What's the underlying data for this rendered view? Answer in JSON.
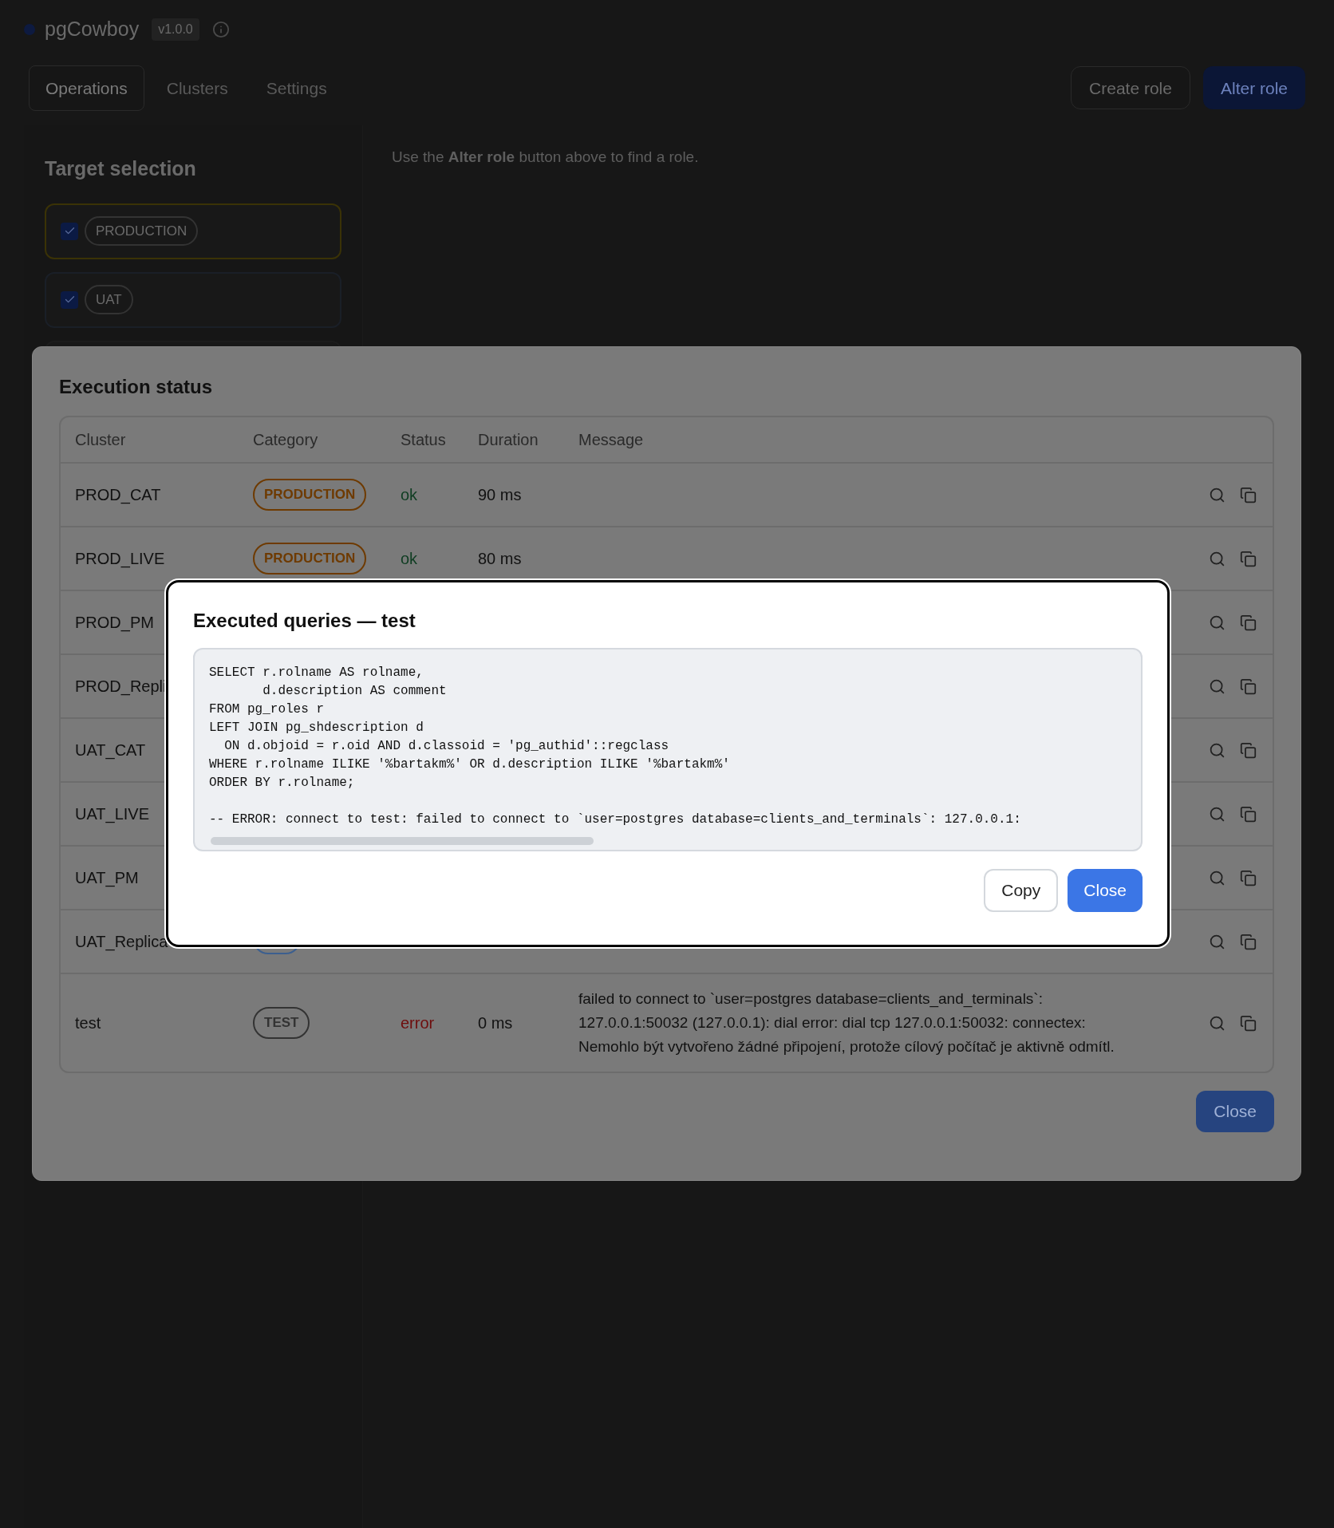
{
  "app": {
    "name": "pgCowboy",
    "version": "v1.0.0",
    "tabs": [
      {
        "label": "Operations",
        "selected": true
      },
      {
        "label": "Clusters",
        "selected": false
      },
      {
        "label": "Settings",
        "selected": false
      }
    ],
    "actions": [
      {
        "label": "Create role",
        "kind": "secondary"
      },
      {
        "label": "Alter role",
        "kind": "primary"
      }
    ],
    "sidebar": {
      "title": "Target selection",
      "targets": [
        {
          "label": "PRODUCTION",
          "checked": true,
          "color": "#3a3206"
        },
        {
          "label": "UAT",
          "checked": true,
          "color": "#1a1f27"
        }
      ]
    },
    "main_hint": "Use the **Alter role** button above to find a role."
  },
  "execution": {
    "title": "Execution status",
    "columns": [
      "Cluster",
      "Category",
      "Status",
      "Duration",
      "Message"
    ],
    "rows": [
      {
        "cluster": "PROD_CAT",
        "category": {
          "label": "PRODUCTION",
          "color": "#6e3a00"
        },
        "status": {
          "label": "ok",
          "kind": "ok"
        },
        "duration": "90 ms"
      },
      {
        "cluster": "PROD_LIVE",
        "category": {
          "label": "PRODUCTION",
          "color": "#6e3a00"
        },
        "status": {
          "label": "ok",
          "kind": "ok"
        },
        "duration": "80 ms"
      },
      {
        "cluster": "PROD_PM"
      },
      {
        "cluster": "PROD_Repli"
      },
      {
        "cluster": "UAT_CAT"
      },
      {
        "cluster": "UAT_LIVE"
      },
      {
        "cluster": "UAT_PM"
      },
      {
        "cluster": "UAT_Replica",
        "category": {
          "color": "#3c5f8f"
        }
      },
      {
        "cluster": "test",
        "category": {
          "label": "TEST",
          "color": "#333333"
        },
        "status": {
          "label": "error",
          "kind": "error"
        },
        "duration": "0 ms",
        "message": "failed to connect to `user=postgres database=clients_and_terminals`: 127.0.0.1:50032 (127.0.0.1): dial error: dial tcp 127.0.0.1:50032: connectex: Nemohlo být vytvořeno žádné připojení, protože cílový počítač je aktivně odmítl."
      }
    ],
    "close_label": "Close"
  },
  "dialog": {
    "title": "Executed queries — test",
    "code": "SELECT r.rolname AS rolname,\n       d.description AS comment\nFROM pg_roles r\nLEFT JOIN pg_shdescription d\n  ON d.objoid = r.oid AND d.classoid = 'pg_authid'::regclass\nWHERE r.rolname ILIKE '%bartakm%' OR d.description ILIKE '%bartakm%'\nORDER BY r.rolname;\n\n-- ERROR: connect to test: failed to connect to `user=postgres database=clients_and_terminals`: 127.0.0.1:",
    "buttons": [
      {
        "label": "Copy",
        "kind": "secondary"
      },
      {
        "label": "Close",
        "kind": "primary"
      }
    ]
  }
}
